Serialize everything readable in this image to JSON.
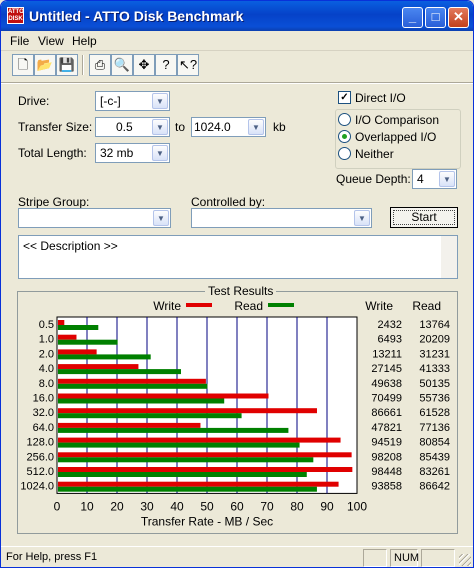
{
  "window": {
    "title": "Untitled - ATTO Disk Benchmark",
    "app_icon_text": "ATTO DISK"
  },
  "menu": [
    "File",
    "View",
    "Help"
  ],
  "toolbar_icons": [
    "new-icon",
    "open-icon",
    "save-icon",
    "print-icon",
    "print-preview-icon",
    "move-icon",
    "about-icon",
    "context-help-icon"
  ],
  "form": {
    "drive_label": "Drive:",
    "drive_value": "[-c-]",
    "transfer_size_label": "Transfer Size:",
    "transfer_from": "0.5",
    "to_label": "to",
    "transfer_to": "1024.0",
    "kb_label": "kb",
    "total_length_label": "Total Length:",
    "total_length_value": "32 mb",
    "direct_io_label": "Direct I/O",
    "direct_io_checked": true,
    "io_comparison_label": "I/O Comparison",
    "overlapped_io_label": "Overlapped I/O",
    "neither_label": "Neither",
    "selected_mode": "Overlapped I/O",
    "queue_depth_label": "Queue Depth:",
    "queue_depth_value": "4",
    "stripe_group_label": "Stripe Group:",
    "stripe_group_value": "",
    "controlled_by_label": "Controlled by:",
    "controlled_by_value": "",
    "start_label": "Start",
    "description": "<< Description >>"
  },
  "results": {
    "title": "Test Results",
    "write_col": "Write",
    "read_col": "Read"
  },
  "chart_data": {
    "type": "bar",
    "orientation": "horizontal",
    "categories": [
      "0.5",
      "1.0",
      "2.0",
      "4.0",
      "8.0",
      "16.0",
      "32.0",
      "64.0",
      "128.0",
      "256.0",
      "512.0",
      "1024.0"
    ],
    "series": [
      {
        "name": "Write",
        "color": "#e00000",
        "values": [
          2432,
          6493,
          13211,
          27145,
          49638,
          70499,
          86661,
          47821,
          94519,
          98208,
          98448,
          93858
        ]
      },
      {
        "name": "Read",
        "color": "#008000",
        "values": [
          13764,
          20209,
          31231,
          41333,
          50135,
          55736,
          61528,
          77136,
          80854,
          85439,
          83261,
          86642
        ]
      }
    ],
    "xlabel": "Transfer Rate - MB / Sec",
    "xlim": [
      0,
      100
    ],
    "xticks": [
      0,
      10,
      20,
      30,
      40,
      50,
      60,
      70,
      80,
      90,
      100
    ],
    "grid": true,
    "legend_position": "top"
  },
  "status": {
    "help_text": "For Help, press F1",
    "num_indicator": "NUM"
  }
}
